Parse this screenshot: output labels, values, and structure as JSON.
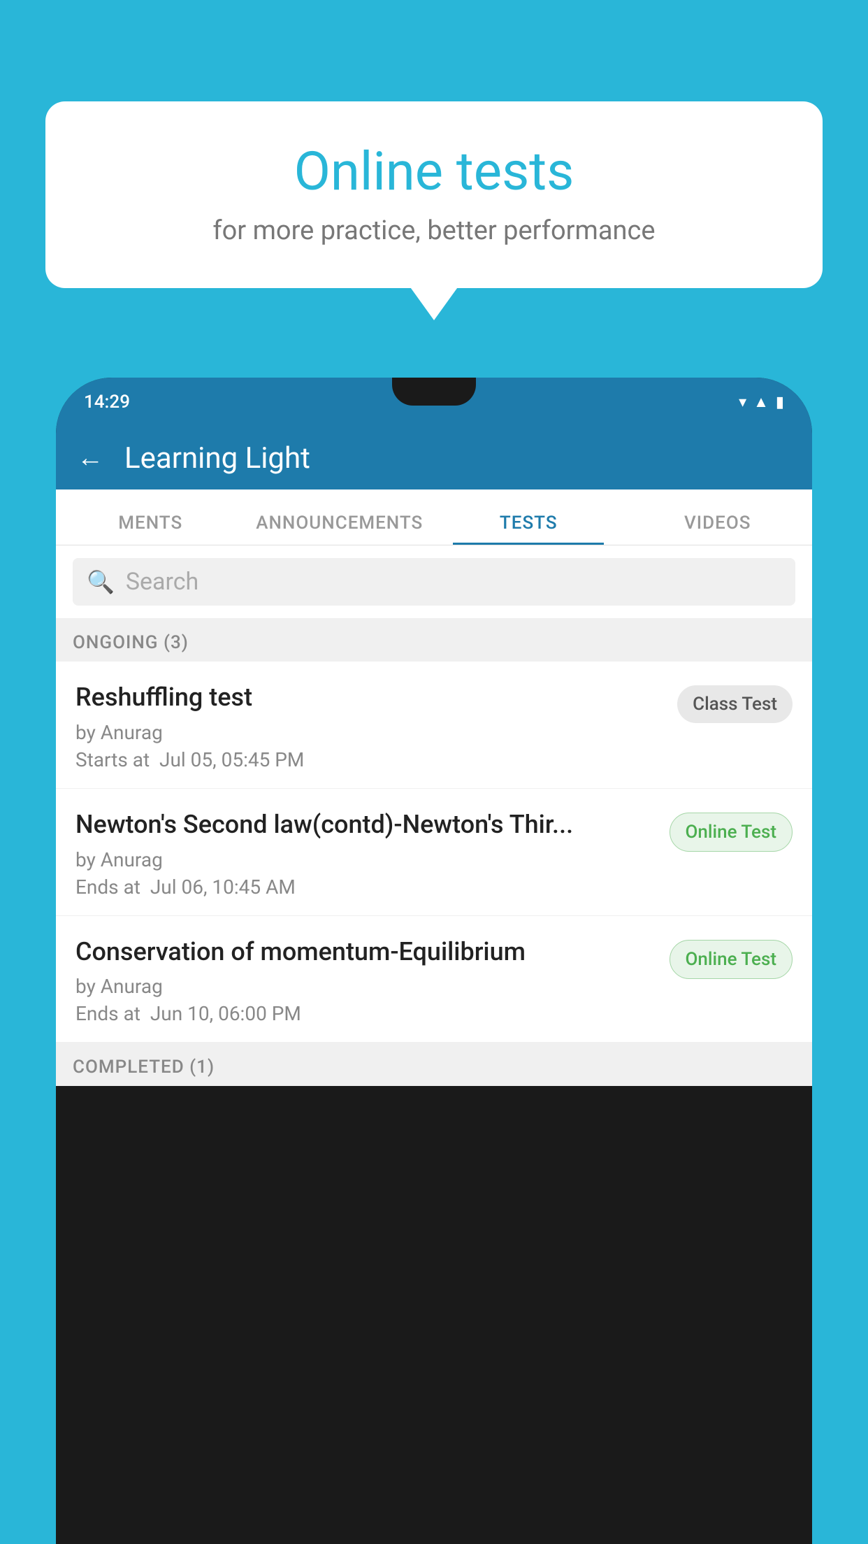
{
  "background_color": "#29b6d8",
  "bubble": {
    "title": "Online tests",
    "subtitle": "for more practice, better performance"
  },
  "phone": {
    "status_bar": {
      "time": "14:29",
      "icons": [
        "wifi",
        "signal",
        "battery"
      ]
    },
    "app_bar": {
      "title": "Learning Light",
      "back_label": "←"
    },
    "tabs": [
      {
        "label": "MENTS",
        "active": false
      },
      {
        "label": "ANNOUNCEMENTS",
        "active": false
      },
      {
        "label": "TESTS",
        "active": true
      },
      {
        "label": "VIDEOS",
        "active": false
      }
    ],
    "search": {
      "placeholder": "Search"
    },
    "section_ongoing": {
      "label": "ONGOING (3)"
    },
    "tests": [
      {
        "name": "Reshuffling test",
        "author": "by Anurag",
        "date_label": "Starts at",
        "date": "Jul 05, 05:45 PM",
        "badge": "Class Test",
        "badge_type": "class"
      },
      {
        "name": "Newton's Second law(contd)-Newton's Thir...",
        "author": "by Anurag",
        "date_label": "Ends at",
        "date": "Jul 06, 10:45 AM",
        "badge": "Online Test",
        "badge_type": "online"
      },
      {
        "name": "Conservation of momentum-Equilibrium",
        "author": "by Anurag",
        "date_label": "Ends at",
        "date": "Jun 10, 06:00 PM",
        "badge": "Online Test",
        "badge_type": "online"
      }
    ],
    "section_completed": {
      "label": "COMPLETED (1)"
    }
  }
}
